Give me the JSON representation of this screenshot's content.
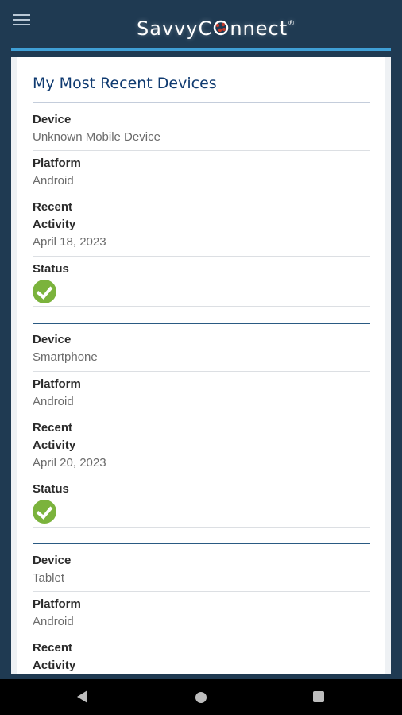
{
  "header": {
    "logo_left": "SavvyC",
    "logo_right": "nnect",
    "logo_mark": "®"
  },
  "card": {
    "title": "My Most Recent Devices"
  },
  "devices": [
    {
      "device_label": "Device",
      "device_value": "Unknown Mobile Device",
      "platform_label": "Platform",
      "platform_value": "Android",
      "activity_label_1": "Recent",
      "activity_label_2": "Activity",
      "activity_value": "April 18, 2023",
      "status_label": "Status",
      "status": "active"
    },
    {
      "device_label": "Device",
      "device_value": "Smartphone",
      "platform_label": "Platform",
      "platform_value": "Android",
      "activity_label_1": "Recent",
      "activity_label_2": "Activity",
      "activity_value": "April 20, 2023",
      "status_label": "Status",
      "status": "active"
    },
    {
      "device_label": "Device",
      "device_value": "Tablet",
      "platform_label": "Platform",
      "platform_value": "Android",
      "activity_label_1": "Recent",
      "activity_label_2": "Activity"
    }
  ],
  "icons": {
    "menu": "hamburger-menu-icon",
    "status": "check-circle-icon",
    "back": "back-triangle-icon",
    "home": "home-circle-icon",
    "recent": "recent-square-icon"
  },
  "colors": {
    "header_bg": "#1f3a52",
    "accent_line": "#3f9fd6",
    "title": "#0f3a70",
    "check": "#7bb33c"
  }
}
